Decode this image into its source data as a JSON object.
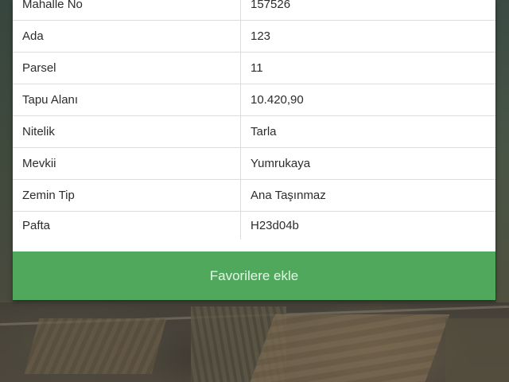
{
  "parcel_info": {
    "rows": [
      {
        "label": "Mahalle No",
        "value": "157526"
      },
      {
        "label": "Ada",
        "value": "123"
      },
      {
        "label": "Parsel",
        "value": "11"
      },
      {
        "label": "Tapu Alanı",
        "value": "10.420,90"
      },
      {
        "label": "Nitelik",
        "value": "Tarla"
      },
      {
        "label": "Mevkii",
        "value": "Yumrukaya"
      },
      {
        "label": "Zemin Tip",
        "value": "Ana Taşınmaz"
      },
      {
        "label": "Pafta",
        "value": "H23d04b"
      }
    ]
  },
  "actions": {
    "add_favorites_label": "Favorilere ekle"
  },
  "colors": {
    "button_green": "#4fa85c"
  }
}
